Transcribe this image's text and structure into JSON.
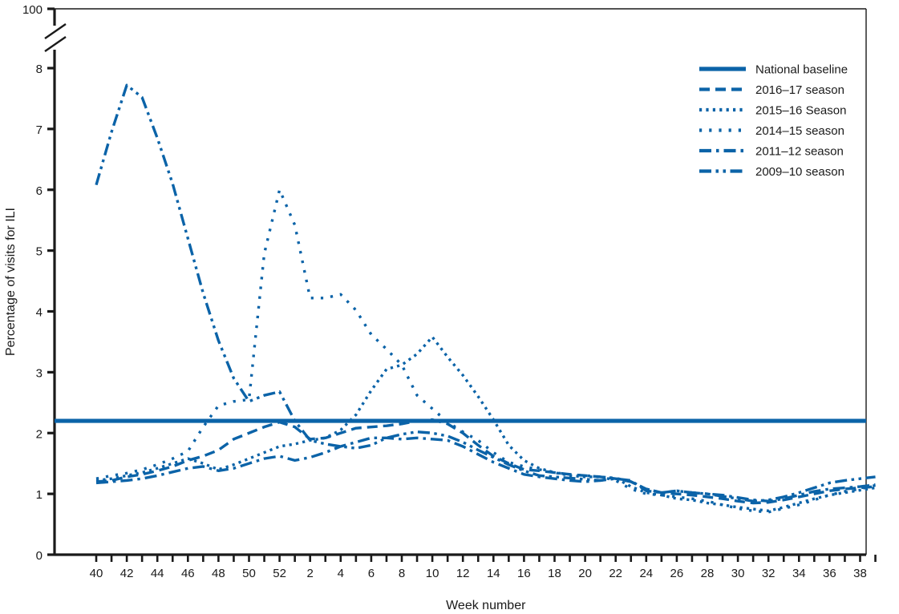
{
  "chart_data": {
    "type": "line",
    "title": "",
    "xlabel": "Week number",
    "ylabel": "Percentage of visits for ILI",
    "ylim": [
      0,
      8
    ],
    "y_axis_break": {
      "from": 8,
      "to": 100,
      "top_label": "100"
    },
    "y_ticks": [
      "0",
      "1",
      "2",
      "3",
      "4",
      "5",
      "6",
      "7",
      "8",
      "100"
    ],
    "grid": false,
    "legend_position": "top-right",
    "x": [
      40,
      41,
      42,
      43,
      44,
      45,
      46,
      47,
      48,
      49,
      50,
      51,
      52,
      1,
      2,
      3,
      4,
      5,
      6,
      7,
      8,
      9,
      10,
      11,
      12,
      13,
      14,
      15,
      16,
      17,
      18,
      19,
      20,
      21,
      22,
      23,
      24,
      25,
      26,
      27,
      28,
      29,
      30,
      31,
      32,
      33,
      34,
      35,
      36,
      37,
      38,
      39
    ],
    "x_tick_labels": [
      "40",
      "42",
      "44",
      "46",
      "48",
      "50",
      "52",
      "2",
      "4",
      "6",
      "8",
      "10",
      "12",
      "14",
      "16",
      "18",
      "20",
      "22",
      "24",
      "26",
      "28",
      "30",
      "32",
      "34",
      "36",
      "38"
    ],
    "national_baseline": 2.2,
    "series": [
      {
        "name": "National baseline",
        "style": "solid",
        "color": "#0b63a8",
        "constant": 2.2,
        "values": [
          2.2,
          2.2,
          2.2,
          2.2,
          2.2,
          2.2,
          2.2,
          2.2,
          2.2,
          2.2,
          2.2,
          2.2,
          2.2,
          2.2,
          2.2,
          2.2,
          2.2,
          2.2,
          2.2,
          2.2,
          2.2,
          2.2,
          2.2,
          2.2,
          2.2,
          2.2,
          2.2,
          2.2,
          2.2,
          2.2,
          2.2,
          2.2,
          2.2,
          2.2,
          2.2,
          2.2,
          2.2,
          2.2,
          2.2,
          2.2,
          2.2,
          2.2,
          2.2,
          2.2,
          2.2,
          2.2,
          2.2,
          2.2,
          2.2,
          2.2,
          2.2,
          2.2
        ]
      },
      {
        "name": "2016–17 season",
        "style": "dashed",
        "color": "#0b63a8",
        "values": [
          1.2,
          1.22,
          1.28,
          1.32,
          1.38,
          1.45,
          1.55,
          1.62,
          1.72,
          1.9,
          2.0,
          2.1,
          2.18,
          2.1,
          1.9,
          1.92,
          2.0,
          2.08,
          2.1,
          2.12,
          2.15,
          2.2,
          2.22,
          2.15,
          2.0,
          1.8,
          1.62,
          1.5,
          1.4,
          1.38,
          1.35,
          1.32,
          1.3,
          1.28,
          1.25,
          1.2,
          1.08,
          1.02,
          1.0,
          0.98,
          0.95,
          0.92,
          0.88,
          0.85,
          0.86,
          0.9,
          0.95,
          1.0,
          1.05,
          1.08,
          1.1,
          1.12
        ]
      },
      {
        "name": "2015–16 Season",
        "style": "dotted",
        "color": "#0b63a8",
        "values": [
          1.22,
          1.25,
          1.3,
          1.35,
          1.42,
          1.5,
          1.58,
          1.5,
          1.4,
          1.48,
          1.58,
          1.68,
          1.78,
          1.82,
          1.88,
          1.92,
          2.05,
          2.3,
          2.7,
          3.05,
          3.12,
          3.3,
          3.58,
          3.25,
          2.95,
          2.6,
          2.22,
          1.8,
          1.55,
          1.42,
          1.35,
          1.3,
          1.28,
          1.28,
          1.26,
          1.12,
          1.02,
          0.98,
          0.92,
          0.9,
          0.85,
          0.82,
          0.78,
          0.75,
          0.72,
          0.78,
          0.85,
          0.92,
          0.98,
          1.02,
          1.06,
          1.1
        ]
      },
      {
        "name": "2014–15 season",
        "style": "sparse-dotted",
        "color": "#0b63a8",
        "values": [
          1.25,
          1.3,
          1.34,
          1.4,
          1.48,
          1.58,
          1.7,
          2.1,
          2.45,
          2.52,
          2.55,
          4.95,
          6.0,
          5.42,
          4.22,
          4.22,
          4.28,
          4.02,
          3.62,
          3.38,
          3.12,
          2.62,
          2.4,
          2.18,
          2.02,
          1.88,
          1.68,
          1.52,
          1.45,
          1.4,
          1.35,
          1.32,
          1.3,
          1.28,
          1.22,
          1.08,
          1.0,
          0.98,
          0.95,
          0.92,
          0.88,
          0.82,
          0.76,
          0.72,
          0.7,
          0.76,
          0.82,
          0.9,
          0.98,
          1.04,
          1.08,
          1.14
        ]
      },
      {
        "name": "2011–12 season",
        "style": "dash-dot-long",
        "color": "#0b63a8",
        "values": [
          1.18,
          1.2,
          1.22,
          1.25,
          1.3,
          1.36,
          1.42,
          1.45,
          1.38,
          1.42,
          1.5,
          1.58,
          1.62,
          1.55,
          1.6,
          1.68,
          1.78,
          1.85,
          1.92,
          1.92,
          1.9,
          1.92,
          1.9,
          1.88,
          1.78,
          1.65,
          1.52,
          1.42,
          1.32,
          1.28,
          1.25,
          1.22,
          1.2,
          1.22,
          1.25,
          1.22,
          1.05,
          1.02,
          1.05,
          1.02,
          1.0,
          0.98,
          0.94,
          0.9,
          0.88,
          0.92,
          0.98,
          1.04,
          1.08,
          1.1,
          1.12,
          1.15
        ]
      },
      {
        "name": "2009–10 season",
        "style": "dash-dot-dot",
        "color": "#0b63a8",
        "values": [
          6.08,
          6.95,
          7.72,
          7.52,
          6.85,
          6.1,
          5.2,
          4.3,
          3.52,
          2.9,
          2.52,
          2.62,
          2.68,
          2.2,
          1.88,
          1.82,
          1.78,
          1.75,
          1.8,
          1.92,
          1.98,
          2.02,
          2.0,
          1.95,
          1.85,
          1.72,
          1.6,
          1.48,
          1.38,
          1.3,
          1.28,
          1.26,
          1.24,
          1.22,
          1.26,
          1.2,
          1.08,
          1.02,
          1.05,
          1.02,
          1.0,
          0.96,
          0.92,
          0.88,
          0.9,
          0.95,
          1.02,
          1.1,
          1.18,
          1.22,
          1.25,
          1.28
        ]
      }
    ]
  },
  "legend": {
    "items": [
      {
        "label": "National baseline",
        "style": "solid"
      },
      {
        "label": "2016–17 season",
        "style": "dashed"
      },
      {
        "label": "2015–16 Season",
        "style": "dotted"
      },
      {
        "label": "2014–15 season",
        "style": "sparse-dotted"
      },
      {
        "label": "2011–12 season",
        "style": "dash-dot-long"
      },
      {
        "label": "2009–10 season",
        "style": "dash-dot-dot"
      }
    ]
  },
  "colors": {
    "series_blue": "#0b63a8",
    "axis_black": "#1a1a1a",
    "background": "#ffffff"
  }
}
